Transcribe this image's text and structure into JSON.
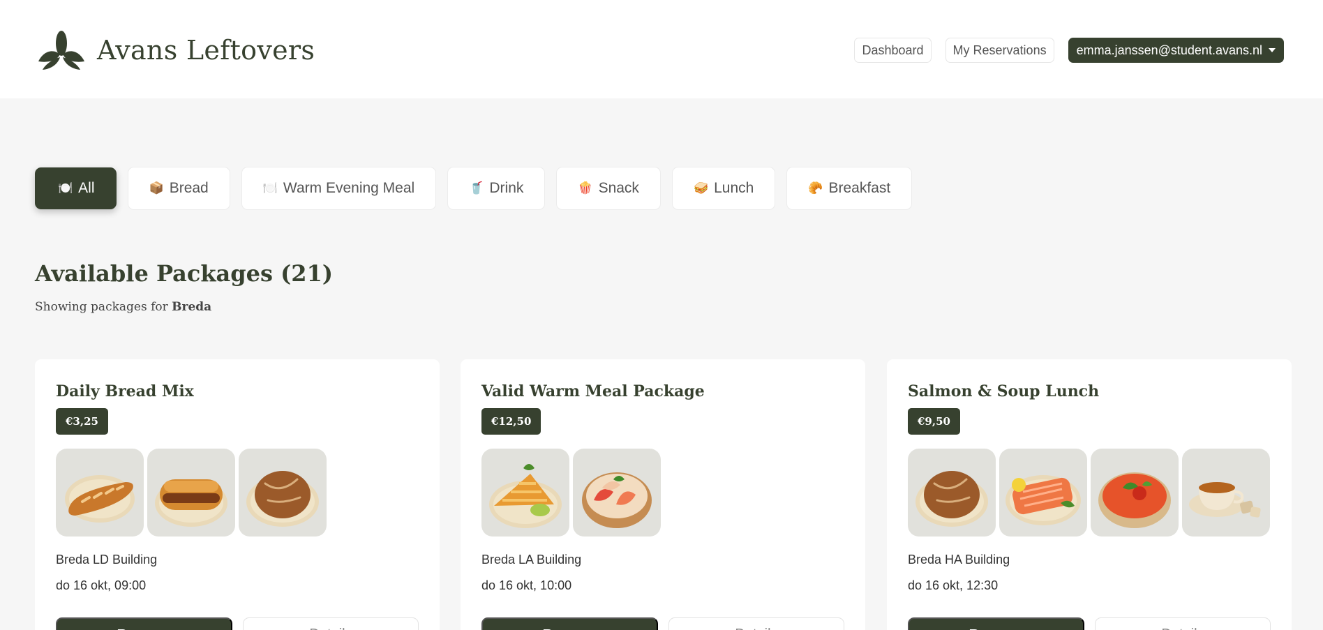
{
  "header": {
    "brand": "Avans Leftovers",
    "logo_icon": "leaf-logo-icon",
    "nav": [
      "Dashboard",
      "My Reservations"
    ],
    "user_email": "emma.janssen@student.avans.nl"
  },
  "filters": [
    {
      "emoji": "🍽️",
      "icon": "plate-icon",
      "label": "All",
      "active": true
    },
    {
      "emoji": "📦",
      "icon": "box-icon",
      "label": "Bread",
      "active": false
    },
    {
      "emoji": "🍽️",
      "icon": "plate-icon",
      "label": "Warm Evening Meal",
      "active": false
    },
    {
      "emoji": "🥤",
      "icon": "cup-icon",
      "label": "Drink",
      "active": false
    },
    {
      "emoji": "🍿",
      "icon": "popcorn-icon",
      "label": "Snack",
      "active": false
    },
    {
      "emoji": "🥪",
      "icon": "sandwich-icon",
      "label": "Lunch",
      "active": false
    },
    {
      "emoji": "🥐",
      "icon": "croissant-icon",
      "label": "Breakfast",
      "active": false
    }
  ],
  "main": {
    "title": "Available Packages (21)",
    "subtitle_prefix": "Showing packages for ",
    "city": "Breda"
  },
  "packages": [
    {
      "name": "Daily Bread Mix",
      "price": "€3,25",
      "location": "Breda LD Building",
      "datetime": "do 16 okt, 09:00",
      "items": [
        "baguette",
        "sausage-roll",
        "bread-loaf"
      ],
      "primary_label": "Reserve",
      "secondary_label": "Details"
    },
    {
      "name": "Valid Warm Meal Package",
      "price": "€12,50",
      "location": "Breda LA Building",
      "datetime": "do 16 okt, 10:00",
      "items": [
        "apple-pie",
        "apple-slices"
      ],
      "primary_label": "Reserve",
      "secondary_label": "Details"
    },
    {
      "name": "Salmon & Soup Lunch",
      "price": "€9,50",
      "location": "Breda HA Building",
      "datetime": "do 16 okt, 12:30",
      "items": [
        "bread-loaf",
        "salmon",
        "tomato-soup",
        "tea"
      ],
      "primary_label": "Reserve",
      "secondary_label": "Details"
    }
  ],
  "colors": {
    "brand_dark": "#37412f",
    "page_bg": "#f6f6f6",
    "card_bg": "#ffffff",
    "thumb_bg": "#e1e1dc"
  }
}
